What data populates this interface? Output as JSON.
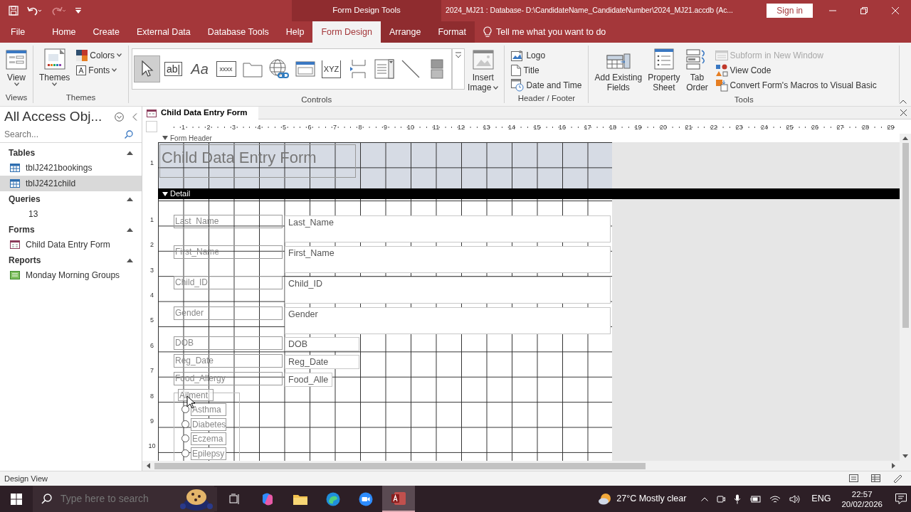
{
  "title_bar": {
    "quick_access": [
      {
        "disabled": false
      },
      {
        "disabled": false
      },
      {
        "disabled": true
      },
      {
        "disabled": false
      }
    ],
    "context_label": "Form Design Tools",
    "title": "2024_MJ21 : Database- D:\\CandidateName_CandidateNumber\\2024_MJ21.accdb (Ac...",
    "sign_in": "Sign in"
  },
  "tabs": [
    {
      "label": "File",
      "selected": false,
      "contextual": false
    },
    {
      "label": "Home",
      "selected": false,
      "contextual": false
    },
    {
      "label": "Create",
      "selected": false,
      "contextual": false
    },
    {
      "label": "External Data",
      "selected": false,
      "contextual": false
    },
    {
      "label": "Database Tools",
      "selected": false,
      "contextual": false
    },
    {
      "label": "Help",
      "selected": false,
      "contextual": false
    },
    {
      "label": "Form Design",
      "selected": true,
      "contextual": true
    },
    {
      "label": "Arrange",
      "selected": false,
      "contextual": true
    },
    {
      "label": "Format",
      "selected": false,
      "contextual": true
    }
  ],
  "tell_me": "Tell me what you want to do",
  "ribbon": [
    {
      "label": "Views",
      "items": [
        {
          "kind": "large",
          "label": "View",
          "dropdown": true,
          "disabled": false
        }
      ]
    },
    {
      "label": "Themes",
      "items": [
        {
          "kind": "large",
          "label": "Themes",
          "dropdown": true,
          "disabled": false
        },
        {
          "kind": "small",
          "label": "Colors",
          "dropdown": true,
          "disabled": false
        },
        {
          "kind": "small",
          "label": "Fonts",
          "dropdown": true,
          "disabled": false
        }
      ]
    },
    {
      "label": "Controls",
      "items": [
        {
          "kind": "tool",
          "selected": true
        },
        {
          "kind": "tool",
          "text": "ab|",
          "selected": false
        },
        {
          "kind": "tool",
          "text": "Aa",
          "selected": false
        },
        {
          "kind": "tool",
          "text": "xxxx",
          "selected": false
        },
        {
          "kind": "tool",
          "selected": false
        },
        {
          "kind": "tool",
          "selected": false
        },
        {
          "kind": "tool",
          "selected": false
        },
        {
          "kind": "tool",
          "text": "XYZ",
          "selected": false
        },
        {
          "kind": "tool",
          "selected": false
        },
        {
          "kind": "tool",
          "selected": false
        },
        {
          "kind": "tool",
          "selected": false
        },
        {
          "kind": "tool",
          "selected": false
        },
        {
          "kind": "more"
        },
        {
          "kind": "large",
          "label": "Insert Image",
          "dropdown": true,
          "disabled": false
        }
      ]
    },
    {
      "label": "Header / Footer",
      "items": [
        {
          "kind": "small",
          "label": "Logo",
          "disabled": false
        },
        {
          "kind": "small",
          "label": "Title",
          "disabled": false
        },
        {
          "kind": "small",
          "label": "Date and Time",
          "disabled": false
        }
      ]
    },
    {
      "label": "Tools",
      "items": [
        {
          "kind": "large",
          "label": "Add Existing Fields",
          "disabled": false
        },
        {
          "kind": "large",
          "label": "Property Sheet",
          "disabled": false
        },
        {
          "kind": "large",
          "label": "Tab Order",
          "disabled": false
        },
        {
          "kind": "small",
          "label": "Subform in New Window",
          "disabled": true
        },
        {
          "kind": "small",
          "label": "View Code",
          "disabled": false
        },
        {
          "kind": "small",
          "label": "Convert Form's Macros to Visual Basic",
          "disabled": false
        }
      ]
    }
  ],
  "nav_pane": {
    "title": "All Access Obj...",
    "search": {
      "placeholder": "Search..."
    },
    "groups": [
      {
        "label": "Tables",
        "kind": "table",
        "expanded": true,
        "items": [
          {
            "label": "tblJ2421bookings",
            "selected": false
          },
          {
            "label": "tblJ2421child",
            "selected": true
          }
        ]
      },
      {
        "label": "Queries",
        "kind": "query",
        "expanded": true,
        "items": [
          {
            "label": "13",
            "selected": false
          }
        ]
      },
      {
        "label": "Forms",
        "kind": "form",
        "expanded": true,
        "items": [
          {
            "label": "Child Data Entry Form",
            "selected": false
          }
        ]
      },
      {
        "label": "Reports",
        "kind": "report",
        "expanded": true,
        "items": [
          {
            "label": "Monday Morning Groups",
            "selected": false
          }
        ]
      }
    ]
  },
  "document": {
    "tab": "Child Data Entry Form",
    "ruler_h": [
      "1",
      "2",
      "3",
      "4",
      "5",
      "6",
      "7",
      "8",
      "9",
      "10",
      "11",
      "12",
      "13",
      "14",
      "15",
      "16",
      "17",
      "18",
      "19",
      "20",
      "21",
      "22",
      "23",
      "24",
      "25",
      "26",
      "27",
      "28",
      "29"
    ],
    "ruler_v_header": [
      "1"
    ],
    "ruler_v_detail": [
      "1",
      "2",
      "3",
      "4",
      "5",
      "6",
      "7",
      "8",
      "9",
      "10"
    ],
    "sections": [
      {
        "label": "Form Header"
      },
      {
        "label": "Detail"
      }
    ],
    "title_label": "Child Data Entry Form",
    "fields": [
      {
        "label": "Last_Name",
        "control": "Last_Name",
        "kind": "wide"
      },
      {
        "label": "First_Name",
        "control": "First_Name",
        "kind": "wide"
      },
      {
        "label": "Child_ID",
        "control": "Child_ID",
        "kind": "wide"
      },
      {
        "label": "Gender",
        "control": "Gender",
        "kind": "wide"
      },
      {
        "label": "DOB",
        "control": "DOB",
        "kind": "medium"
      },
      {
        "label": "Reg_Date",
        "control": "Reg_Date",
        "kind": "medium"
      },
      {
        "label": "Food_Allergy",
        "control": "Food_Alle",
        "kind": "small"
      }
    ],
    "option_group": {
      "label": "Ailment",
      "options": [
        {
          "label": "Asthma",
          "selected": false
        },
        {
          "label": "Diabetes",
          "selected": false
        },
        {
          "label": "Eczema",
          "selected": false
        },
        {
          "label": "Epilepsy",
          "selected": false
        }
      ]
    }
  },
  "status_bar": {
    "text": "Design View"
  },
  "taskbar": {
    "search": {
      "placeholder": "Type here to search"
    },
    "apps": [
      {
        "active": false
      },
      {
        "active": false
      },
      {
        "active": false
      },
      {
        "active": false
      },
      {
        "active": false
      },
      {
        "active": true
      }
    ],
    "weather": "27°C Mostly clear",
    "language": "ENG",
    "time": "22:57",
    "date": "20/02/2026"
  }
}
